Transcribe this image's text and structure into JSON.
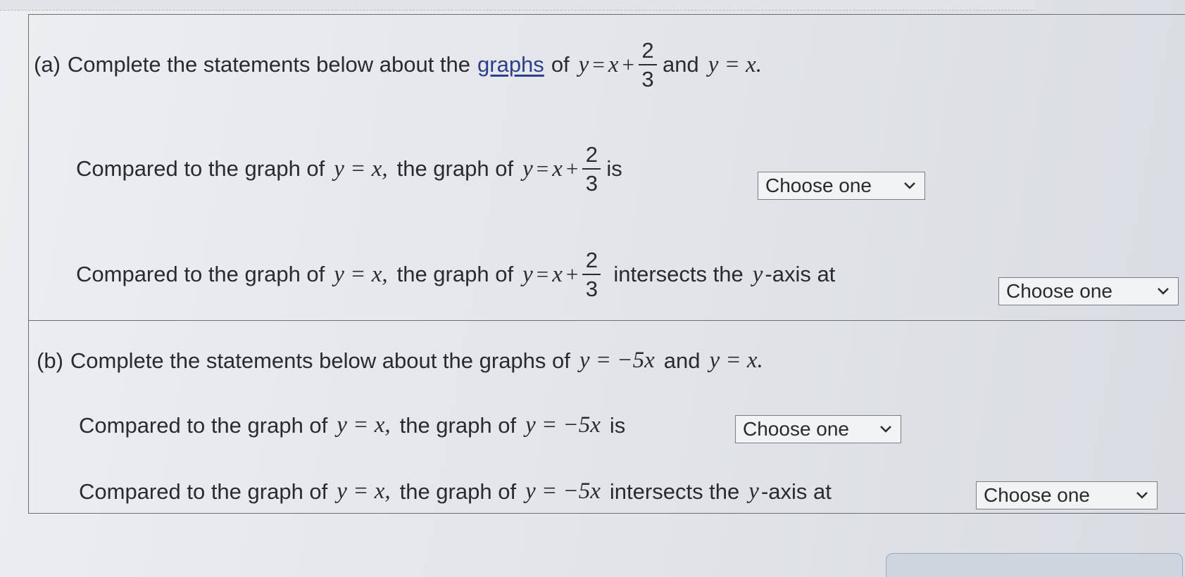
{
  "part_a": {
    "label": "(a)",
    "intro_prefix": "Complete the statements below about the",
    "intro_link": "graphs",
    "intro_of": "of",
    "intro_and": "and",
    "eq1_lhs": "y",
    "eq1_rhs": "x",
    "frac_num": "2",
    "frac_den": "3",
    "eq2": "y = x.",
    "s1_prefix": "Compared to the graph of",
    "s1_eq": "y = x,",
    "s1_middle": "the graph of",
    "s1_suffix": "is",
    "s1_dropdown": "Choose one",
    "s2_prefix": "Compared to the graph of",
    "s2_eq": "y = x,",
    "s2_middle": "the graph of",
    "s2_suffix_a": "intersects the",
    "s2_yvar": "y",
    "s2_suffix_b": "-axis at",
    "s2_dropdown": "Choose one"
  },
  "part_b": {
    "label": "(b)",
    "intro_prefix": "Complete the statements below about the graphs of",
    "eq1": "y = −5x",
    "intro_and": "and",
    "eq2": "y = x.",
    "s1_prefix": "Compared to the graph of",
    "s1_eq": "y = x,",
    "s1_middle": "the graph of",
    "s1_eq2": "y = −5x",
    "s1_suffix": "is",
    "s1_dropdown": "Choose one",
    "s2_prefix": "Compared to the graph of",
    "s2_eq": "y = x,",
    "s2_middle": "the graph of",
    "s2_eq2": "y = −5x",
    "s2_suffix_a": "intersects the",
    "s2_yvar": "y",
    "s2_suffix_b": "-axis at",
    "s2_dropdown": "Choose one"
  },
  "icons": {
    "dropdown": "chevron-down-icon"
  },
  "colors": {
    "link": "#2b3f8c",
    "border": "#6b6e74",
    "text": "#2a2b2e"
  }
}
